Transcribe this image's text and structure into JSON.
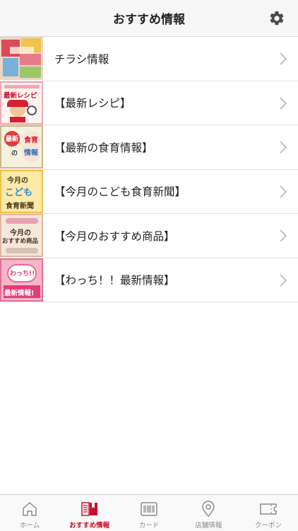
{
  "header": {
    "title": "おすすめ情報"
  },
  "items": [
    {
      "label": "チラシ情報",
      "thumb_icon": "flyer-collage-thumbnail"
    },
    {
      "label": "【最新レシピ】",
      "thumb_icon": "latest-recipe-thumbnail",
      "thumb_text": "最新レシピ"
    },
    {
      "label": "【最新の食育情報】",
      "thumb_icon": "food-education-thumbnail",
      "thumb_text": [
        "最新",
        "の",
        "食育",
        "情報"
      ]
    },
    {
      "label": "【今月のこども食育新聞】",
      "thumb_icon": "kids-newspaper-thumbnail",
      "thumb_text": [
        "今月の",
        "こども",
        "食育新聞"
      ]
    },
    {
      "label": "【今月のおすすめ商品】",
      "thumb_icon": "recommended-products-thumbnail",
      "thumb_text": [
        "今月の",
        "おすすめ商品"
      ]
    },
    {
      "label": "【わっち！！最新情報】",
      "thumb_icon": "wacchi-news-thumbnail",
      "thumb_text": [
        "わっち!!",
        "最新情報!"
      ]
    }
  ],
  "tabs": [
    {
      "label": "ホーム",
      "icon": "home-icon",
      "active": false
    },
    {
      "label": "おすすめ情報",
      "icon": "book-icon",
      "active": true
    },
    {
      "label": "カード",
      "icon": "barcode-icon",
      "active": false
    },
    {
      "label": "店舗情報",
      "icon": "location-pin-icon",
      "active": false
    },
    {
      "label": "クーポン",
      "icon": "coupon-icon",
      "active": false
    }
  ],
  "colors": {
    "accent": "#c8102e",
    "inactive": "#8a8a8a",
    "header_bg": "#f7f7f7"
  }
}
